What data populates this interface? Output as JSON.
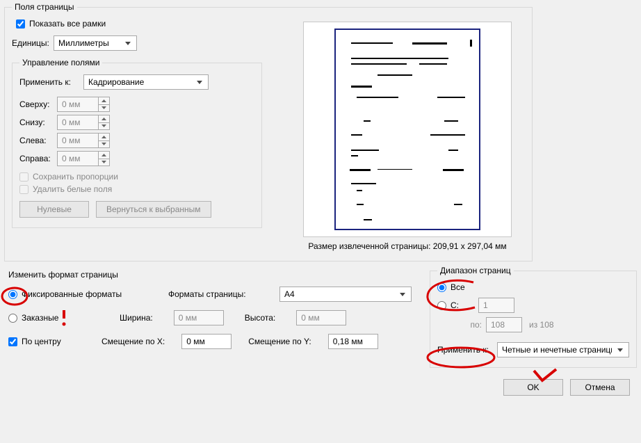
{
  "page_margins": {
    "title": "Поля страницы",
    "show_all_frames": "Показать все рамки",
    "units_label": "Единицы:",
    "units_value": "Миллиметры",
    "manage": {
      "title": "Управление полями",
      "apply_to_label": "Применить к:",
      "apply_to_value": "Кадрирование",
      "top_label": "Сверху:",
      "bottom_label": "Снизу:",
      "left_label": "Слева:",
      "right_label": "Справа:",
      "margin_value": "0 мм",
      "keep_proportions": "Сохранить пропорции",
      "remove_white_margins": "Удалить белые поля",
      "btn_zero": "Нулевые",
      "btn_revert": "Вернуться к выбранным"
    },
    "preview_caption": "Размер извлеченной страницы: 209,91 x 297,04 мм"
  },
  "resize": {
    "title": "Изменить формат страницы",
    "opt_fixed": "Фиксированные форматы",
    "opt_custom": "Заказные",
    "formats_label": "Форматы страницы:",
    "format_value": "A4",
    "width_label": "Ширина:",
    "height_label": "Высота:",
    "dim_value": "0 мм",
    "center": "По центру",
    "offset_x_label": "Смещение по X:",
    "offset_x_value": "0 мм",
    "offset_y_label": "Смещение по Y:",
    "offset_y_value": "0,18 мм"
  },
  "range": {
    "title": "Диапазон страниц",
    "opt_all": "Все",
    "opt_from": "С:",
    "from_value": "1",
    "to_label": "по:",
    "to_value": "108",
    "of_label": "из 108",
    "apply_to_label": "Применить к:",
    "apply_to_value": "Четные и нечетные страницы"
  },
  "footer": {
    "ok": "OK",
    "cancel": "Отмена"
  }
}
